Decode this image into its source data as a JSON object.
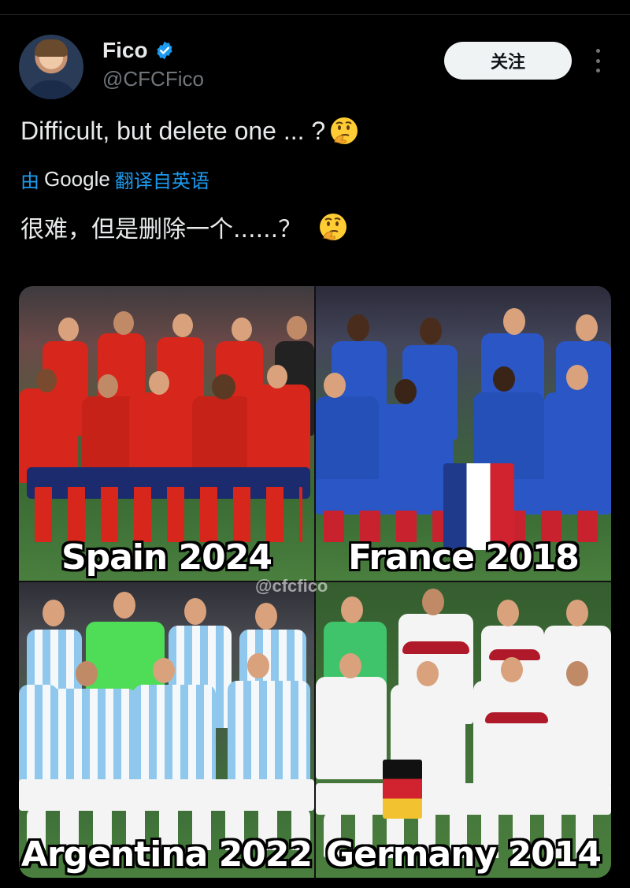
{
  "user": {
    "name": "Fico",
    "handle": "@CFCFico",
    "verified": true
  },
  "actions": {
    "follow_label": "关注"
  },
  "tweet": {
    "text": "Difficult, but delete one ... ?",
    "emoji": "thinking-face-emoji"
  },
  "translation": {
    "by_prefix": "由",
    "provider": "Google",
    "suffix": "翻译自英语",
    "text": "很难，但是删除一个......？"
  },
  "media": {
    "watermark": "@cfcfico",
    "panels": [
      {
        "caption": "Spain 2024"
      },
      {
        "caption": "France 2018"
      },
      {
        "caption": "Argentina 2022"
      },
      {
        "caption": "Germany 2014"
      }
    ]
  },
  "colors": {
    "background": "#000000",
    "accent": "#1d9bf0",
    "secondary_text": "#71767b",
    "spain_kit": "#d7261c",
    "france_kit": "#2a56c6",
    "argentina_kit": "#8fc8ec",
    "germany_kit": "#f4f4f4"
  }
}
